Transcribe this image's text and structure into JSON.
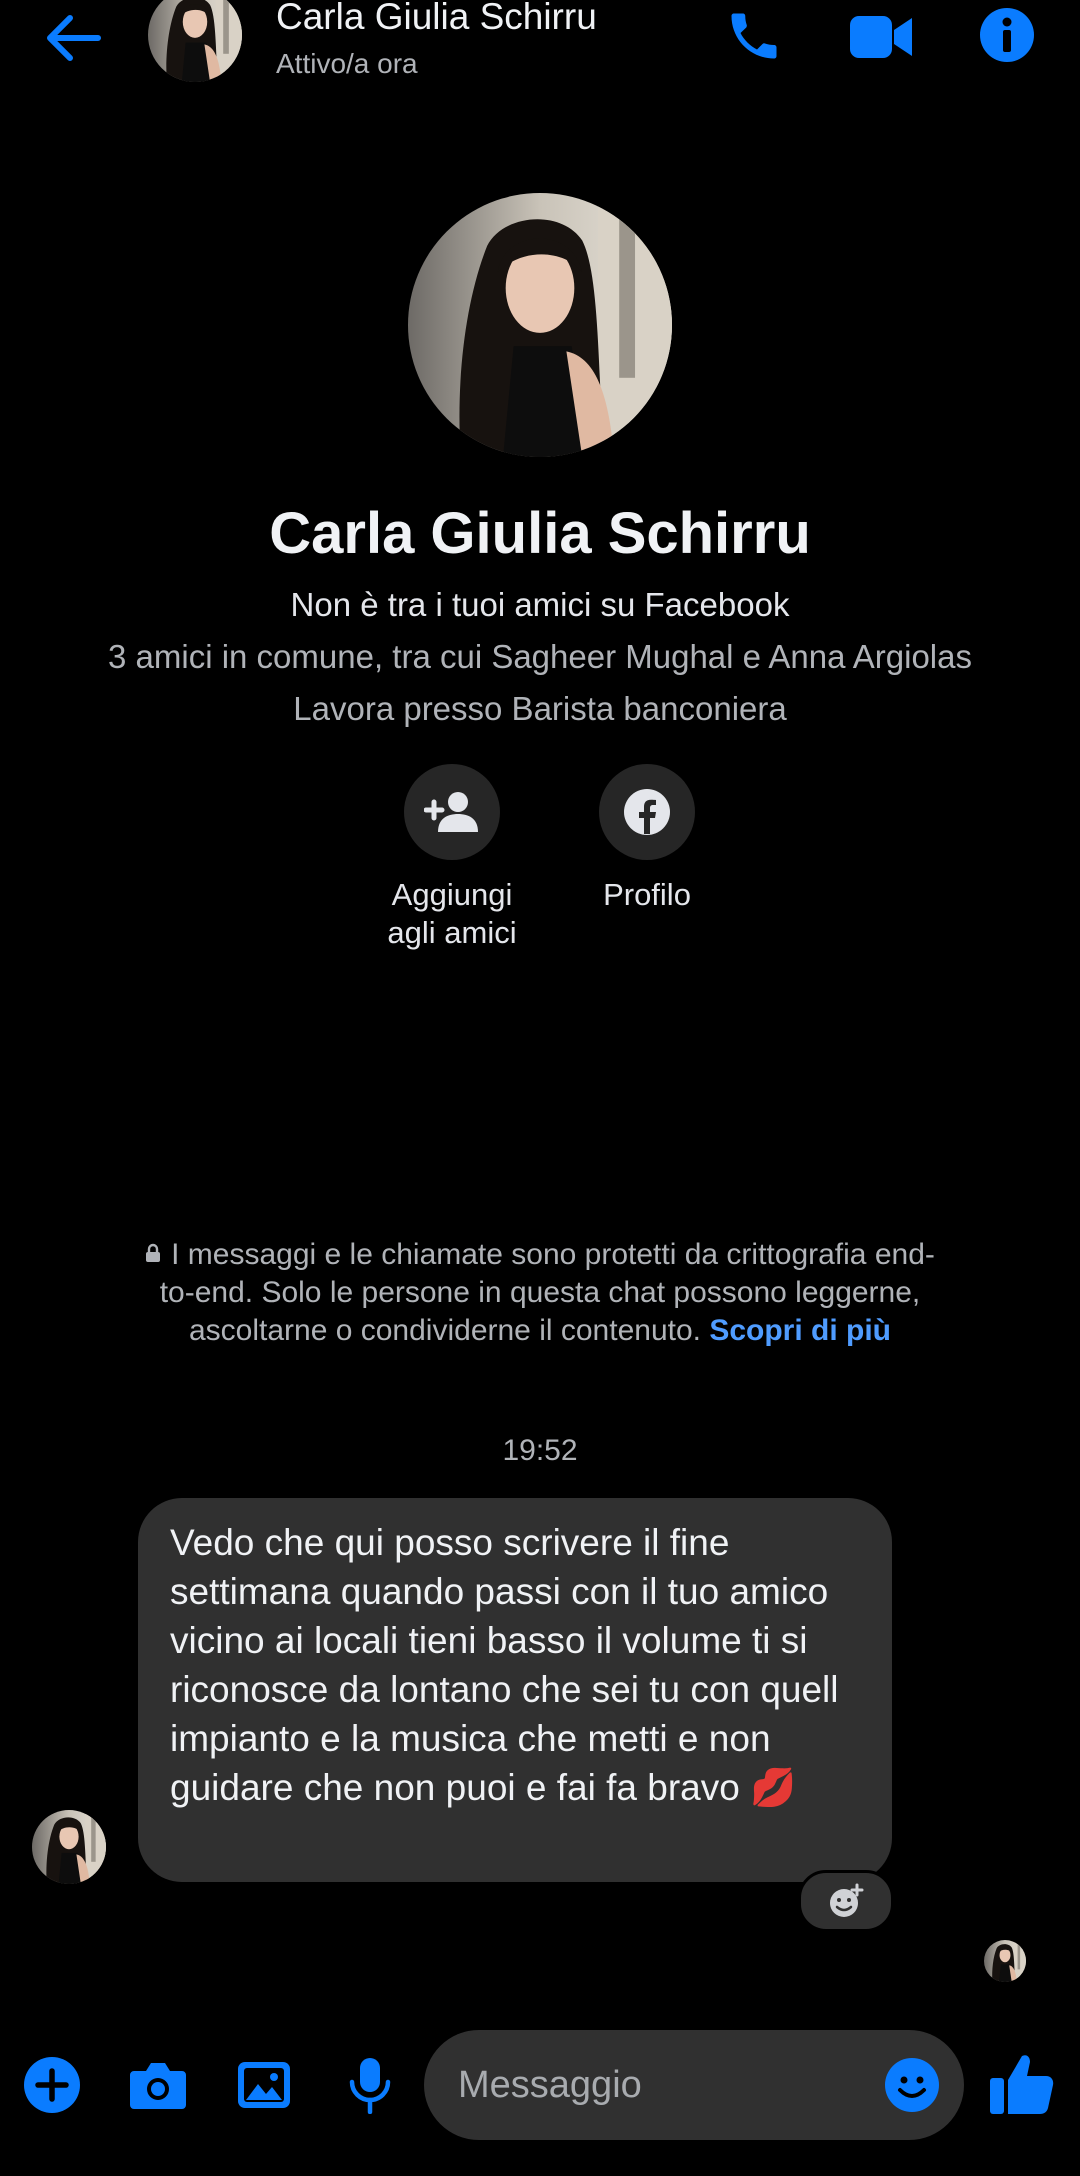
{
  "colors": {
    "accent": "#0a7cff",
    "background": "#000000",
    "bubble": "#303030",
    "link": "#4f9cff"
  },
  "header": {
    "name": "Carla Giulia Schirru",
    "status": "Attivo/a ora",
    "icons": [
      "back-arrow-icon",
      "phone-icon",
      "video-camera-icon",
      "info-icon"
    ]
  },
  "profile": {
    "name": "Carla Giulia Schirru",
    "not_friends": "Non è tra i tuoi amici su Facebook",
    "mutual_friends": "3 amici in comune, tra cui Sagheer Mughal e Anna Argiolas",
    "work": "Lavora presso Barista banconiera",
    "actions": [
      {
        "icon": "add-friend-icon",
        "line1": "Aggiungi",
        "line2": "agli amici"
      },
      {
        "icon": "facebook-icon",
        "label": "Profilo"
      }
    ]
  },
  "encryption": {
    "text": "I messaggi e le chiamate sono protetti da crittografia end-to-end. Solo le persone in questa chat possono leggerne, ascoltarne o condividerne il contenuto.",
    "link": "Scopri di più"
  },
  "timestamp": "19:52",
  "message": {
    "text": "Vedo che qui posso scrivere il fine settimana quando passi con il tuo amico vicino ai locali tieni basso il volume ti si riconosce da lontano che sei tu con quell impianto e la musica che metti e non guidare che non puoi e fai fa bravo 💋"
  },
  "composer": {
    "placeholder": "Messaggio",
    "icons": [
      "plus-icon",
      "camera-icon",
      "gallery-icon",
      "microphone-icon",
      "emoji-icon",
      "thumbs-up-icon"
    ]
  }
}
